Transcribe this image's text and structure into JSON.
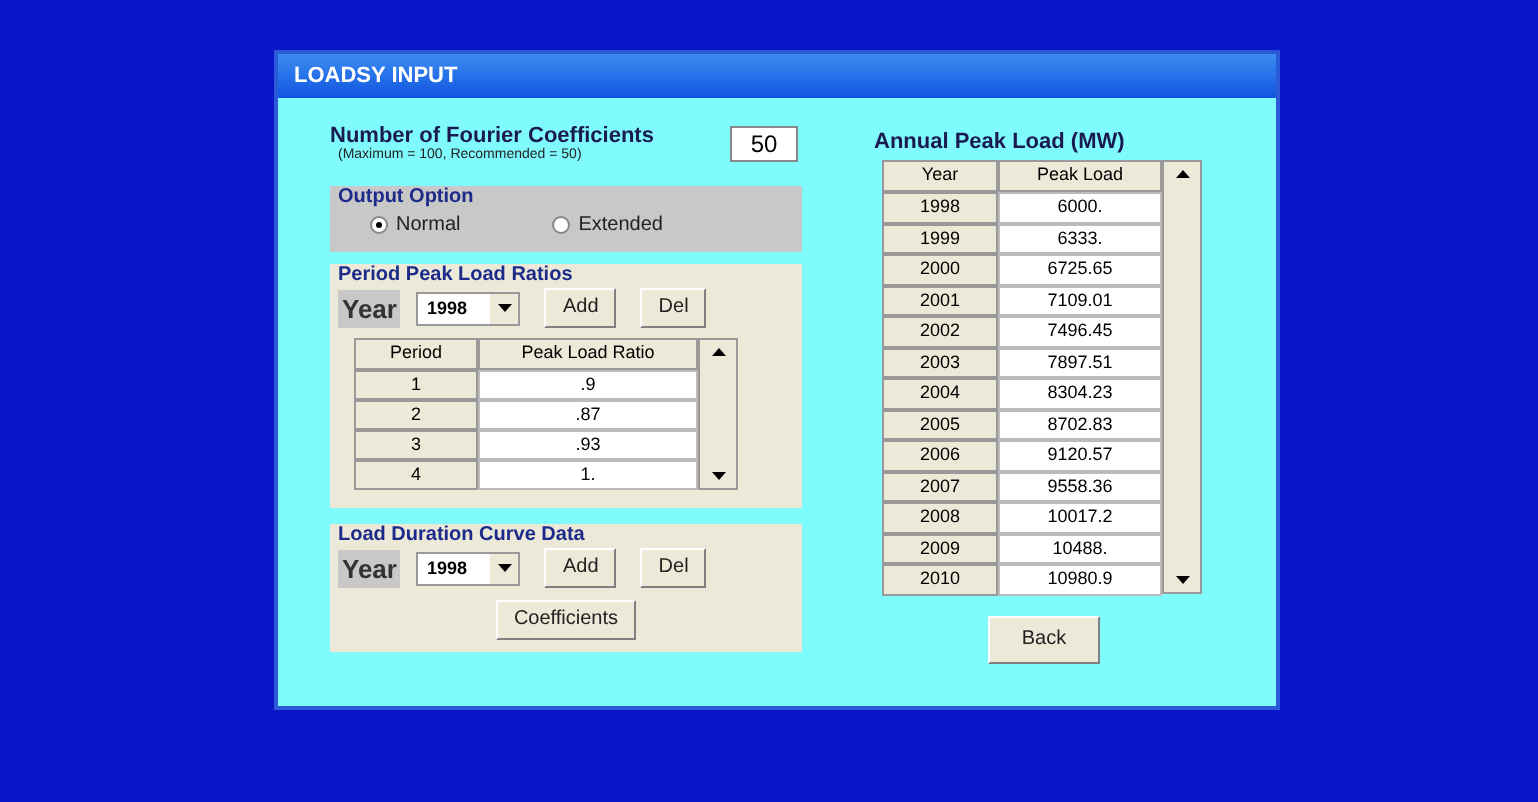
{
  "window": {
    "title": "LOADSY INPUT"
  },
  "fourier": {
    "label": "Number of Fourier Coefficients",
    "hint": "(Maximum = 100, Recommended = 50)",
    "value": "50"
  },
  "output_option": {
    "title": "Output Option",
    "options": [
      {
        "label": "Normal",
        "selected": true
      },
      {
        "label": "Extended",
        "selected": false
      }
    ]
  },
  "period_peak": {
    "title": "Period Peak Load Ratios",
    "year_label": "Year",
    "year": "1998",
    "add": "Add",
    "del": "Del",
    "columns": [
      "Period",
      "Peak Load Ratio"
    ],
    "rows": [
      {
        "period": "1",
        "value": ".9"
      },
      {
        "period": "2",
        "value": ".87"
      },
      {
        "period": "3",
        "value": ".93"
      },
      {
        "period": "4",
        "value": "1."
      }
    ]
  },
  "load_duration": {
    "title": "Load Duration Curve Data",
    "year_label": "Year",
    "year": "1998",
    "add": "Add",
    "del": "Del",
    "coefficients": "Coefficients"
  },
  "annual": {
    "title": "Annual Peak Load (MW)",
    "columns": [
      "Year",
      "Peak Load"
    ],
    "rows": [
      {
        "year": "1998",
        "value": "6000."
      },
      {
        "year": "1999",
        "value": "6333."
      },
      {
        "year": "2000",
        "value": "6725.65"
      },
      {
        "year": "2001",
        "value": "7109.01"
      },
      {
        "year": "2002",
        "value": "7496.45"
      },
      {
        "year": "2003",
        "value": "7897.51"
      },
      {
        "year": "2004",
        "value": "8304.23"
      },
      {
        "year": "2005",
        "value": "8702.83"
      },
      {
        "year": "2006",
        "value": "9120.57"
      },
      {
        "year": "2007",
        "value": "9558.36"
      },
      {
        "year": "2008",
        "value": "10017.2"
      },
      {
        "year": "2009",
        "value": "10488."
      },
      {
        "year": "2010",
        "value": "10980.9"
      }
    ]
  },
  "back": "Back"
}
